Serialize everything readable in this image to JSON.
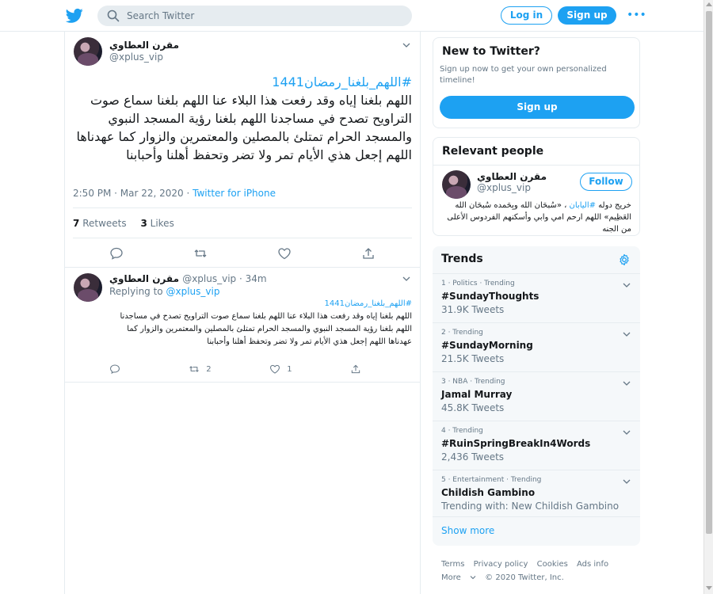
{
  "header": {
    "search_placeholder": "Search Twitter",
    "login_label": "Log in",
    "signup_label": "Sign up",
    "more_label": "•••"
  },
  "tweet": {
    "author_name": "مقرن العطاوي ",
    "handle": "@xplus_vip",
    "hashtag": "#اللهم_بلغنا_رمضان1441",
    "text": "اللهم بلغنا إياه وقد رفعت هذا البلاء عنا اللهم بلغنا سماع صوت التراويح تصدح في مساجدنا اللهم بلغنا رؤية المسجد النبوي والمسجد الحرام تمتلئ بالمصلين والمعتمرين والزوار كما عهدناها اللهم إجعل هذي الأيام تمر ولا تضر وتحفظ أهلنا وأحبابنا",
    "time": "2:50 PM · Mar 22, 2020 · ",
    "source": "Twitter for iPhone",
    "retweets_count": "7",
    "retweets_label": "Retweets",
    "likes_count": "3",
    "likes_label": "Likes"
  },
  "reply": {
    "author_name": "مقرن العطاوي ",
    "handle_time": "@xplus_vip · 34m",
    "replying_prefix": "Replying to ",
    "replying_handle": "@xplus_vip",
    "hashtag": "#اللهم_بلغنا_رمضان1441",
    "text": "اللهم بلغنا إياه وقد رفعت هذا البلاء عنا اللهم بلغنا سماع صوت التراويح تصدح في مساجدنا اللهم بلغنا رؤية المسجد النبوي والمسجد الحرام تمتلئ بالمصلين والمعتمرين والزوار  كما عهدناها اللهم إجعل هذي الأيام تمر ولا تضر وتحفظ أهلنا وأحبابنا",
    "retweets": "2",
    "likes": "1"
  },
  "new_to_twitter": {
    "title": "New to Twitter?",
    "subtitle": "Sign up now to get your own personalized timeline!",
    "signup_label": "Sign up"
  },
  "relevant_people": {
    "title": "Relevant people",
    "name": "مقرن العطاوي ",
    "handle": "@xplus_vip",
    "follow_label": "Follow",
    "bio_prefix": "خريج دوله ",
    "bio_link": "#اليابان",
    "bio_rest": " ، «سُبحَان الله وبِحَمده سُبحَان الله العَظِيم» اللهم ارحم امي وابي وأسكنهم الفردوس الأعلى من الجنه"
  },
  "trends": {
    "title": "Trends",
    "items": [
      {
        "context": "1 · Politics · Trending",
        "name": "#SundayThoughts",
        "count": "31.9K Tweets"
      },
      {
        "context": "2 · Trending",
        "name": "#SundayMorning",
        "count": "21.5K Tweets"
      },
      {
        "context": "3 · NBA · Trending",
        "name": "Jamal Murray",
        "count": "45.8K Tweets"
      },
      {
        "context": "4 · Trending",
        "name": "#RuinSpringBreakIn4Words",
        "count": "2,436 Tweets"
      },
      {
        "context": "5 · Entertainment · Trending",
        "name": "Childish Gambino",
        "count": "Trending with: New Childish Gambino"
      }
    ],
    "show_more": "Show more"
  },
  "footer": {
    "terms": "Terms",
    "privacy": "Privacy policy",
    "cookies": "Cookies",
    "ads": "Ads info",
    "more": "More",
    "copyright": "© 2020 Twitter, Inc."
  },
  "colors": {
    "accent": "#1da1f2",
    "text": "#14171a",
    "muted": "#657786",
    "border": "#e6ecf0"
  }
}
